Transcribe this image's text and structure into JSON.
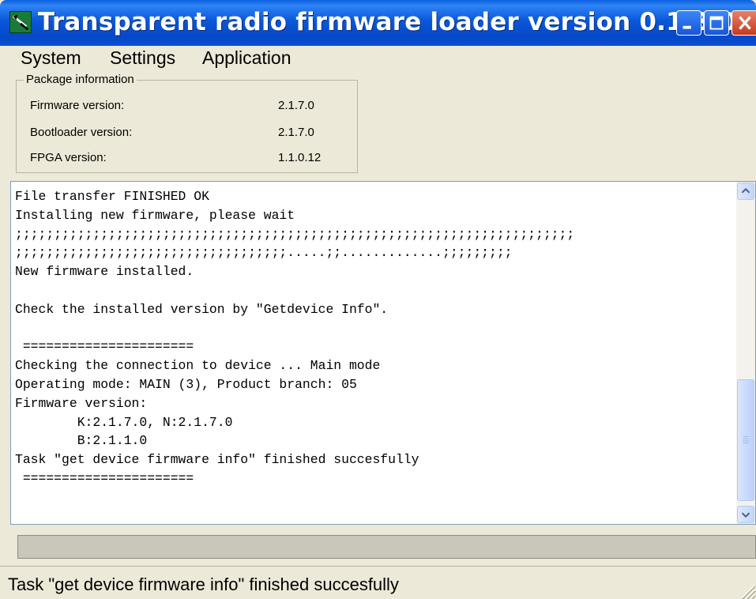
{
  "window": {
    "title": "Transparent radio firmware loader version 0.1.3.0",
    "icon": "app-radio-icon"
  },
  "title_buttons": [
    "minimize-icon",
    "maximize-icon",
    "close-icon"
  ],
  "menu": {
    "system": "System",
    "settings": "Settings",
    "application": "Application"
  },
  "package_info": {
    "title": "Package information",
    "rows": [
      {
        "label": "Firmware version:",
        "value": "2.1.7.0"
      },
      {
        "label": "Bootloader version:",
        "value": "2.1.7.0"
      },
      {
        "label": "FPGA version:",
        "value": "1.1.0.12"
      }
    ]
  },
  "console": {
    "lines": [
      "File transfer FINISHED OK",
      "Installing new firmware, please wait",
      ";;;;;;;;;;;;;;;;;;;;;;;;;;;;;;;;;;;;;;;;;;;;;;;;;;;;;;;;;;;;;;;;;;;;;;;;",
      ";;;;;;;;;;;;;;;;;;;;;;;;;;;;;;;;;;;.....;;.............;;;;;;;;;",
      "New firmware installed.",
      "",
      "Check the installed version by \"Getdevice Info\".",
      "",
      " ======================",
      "Checking the connection to device ... Main mode",
      "Operating mode: MAIN (3), Product branch: 05",
      "Firmware version:",
      "        K:2.1.7.0, N:2.1.7.0",
      "        B:2.1.1.0",
      "Task \"get device firmware info\" finished succesfully",
      " ======================"
    ]
  },
  "progress": {
    "fraction": 0
  },
  "status": {
    "text": "Task \"get device firmware info\" finished succesfully"
  },
  "colors": {
    "titlebar": "#0548c8",
    "window_bg": "#ece9d8",
    "close_button": "#c43b1d"
  }
}
